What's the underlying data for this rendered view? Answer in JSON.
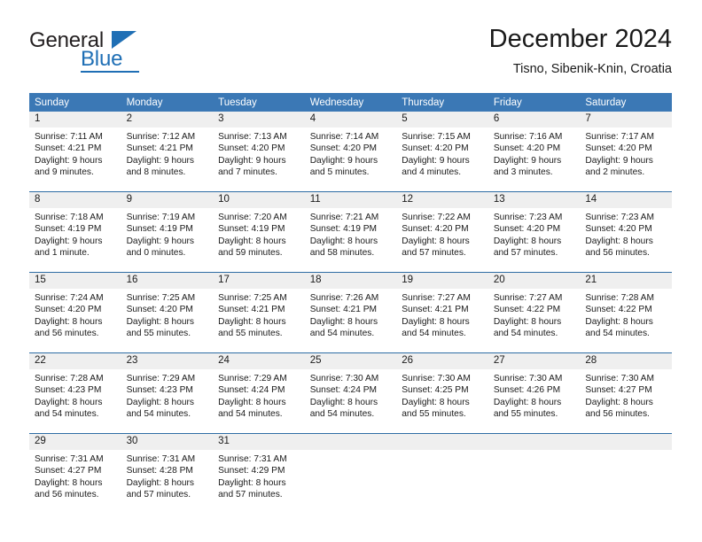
{
  "brand": {
    "name_part1": "General",
    "name_part2": "Blue"
  },
  "header": {
    "title": "December 2024",
    "subtitle": "Tisno, Sibenik-Knin, Croatia"
  },
  "colors": {
    "header_blue": "#3b78b5",
    "row_border_blue": "#2e6da4",
    "daynum_gray": "#efefef",
    "brand_blue": "#1f6fb5"
  },
  "weekday_headers": [
    "Sunday",
    "Monday",
    "Tuesday",
    "Wednesday",
    "Thursday",
    "Friday",
    "Saturday"
  ],
  "labels": {
    "sunrise_prefix": "Sunrise:",
    "sunset_prefix": "Sunset:",
    "daylight_prefix": "Daylight:"
  },
  "weeks": [
    [
      {
        "day": "1",
        "sunrise": "Sunrise: 7:11 AM",
        "sunset": "Sunset: 4:21 PM",
        "daylight": "Daylight: 9 hours and 9 minutes."
      },
      {
        "day": "2",
        "sunrise": "Sunrise: 7:12 AM",
        "sunset": "Sunset: 4:21 PM",
        "daylight": "Daylight: 9 hours and 8 minutes."
      },
      {
        "day": "3",
        "sunrise": "Sunrise: 7:13 AM",
        "sunset": "Sunset: 4:20 PM",
        "daylight": "Daylight: 9 hours and 7 minutes."
      },
      {
        "day": "4",
        "sunrise": "Sunrise: 7:14 AM",
        "sunset": "Sunset: 4:20 PM",
        "daylight": "Daylight: 9 hours and 5 minutes."
      },
      {
        "day": "5",
        "sunrise": "Sunrise: 7:15 AM",
        "sunset": "Sunset: 4:20 PM",
        "daylight": "Daylight: 9 hours and 4 minutes."
      },
      {
        "day": "6",
        "sunrise": "Sunrise: 7:16 AM",
        "sunset": "Sunset: 4:20 PM",
        "daylight": "Daylight: 9 hours and 3 minutes."
      },
      {
        "day": "7",
        "sunrise": "Sunrise: 7:17 AM",
        "sunset": "Sunset: 4:20 PM",
        "daylight": "Daylight: 9 hours and 2 minutes."
      }
    ],
    [
      {
        "day": "8",
        "sunrise": "Sunrise: 7:18 AM",
        "sunset": "Sunset: 4:19 PM",
        "daylight": "Daylight: 9 hours and 1 minute."
      },
      {
        "day": "9",
        "sunrise": "Sunrise: 7:19 AM",
        "sunset": "Sunset: 4:19 PM",
        "daylight": "Daylight: 9 hours and 0 minutes."
      },
      {
        "day": "10",
        "sunrise": "Sunrise: 7:20 AM",
        "sunset": "Sunset: 4:19 PM",
        "daylight": "Daylight: 8 hours and 59 minutes."
      },
      {
        "day": "11",
        "sunrise": "Sunrise: 7:21 AM",
        "sunset": "Sunset: 4:19 PM",
        "daylight": "Daylight: 8 hours and 58 minutes."
      },
      {
        "day": "12",
        "sunrise": "Sunrise: 7:22 AM",
        "sunset": "Sunset: 4:20 PM",
        "daylight": "Daylight: 8 hours and 57 minutes."
      },
      {
        "day": "13",
        "sunrise": "Sunrise: 7:23 AM",
        "sunset": "Sunset: 4:20 PM",
        "daylight": "Daylight: 8 hours and 57 minutes."
      },
      {
        "day": "14",
        "sunrise": "Sunrise: 7:23 AM",
        "sunset": "Sunset: 4:20 PM",
        "daylight": "Daylight: 8 hours and 56 minutes."
      }
    ],
    [
      {
        "day": "15",
        "sunrise": "Sunrise: 7:24 AM",
        "sunset": "Sunset: 4:20 PM",
        "daylight": "Daylight: 8 hours and 56 minutes."
      },
      {
        "day": "16",
        "sunrise": "Sunrise: 7:25 AM",
        "sunset": "Sunset: 4:20 PM",
        "daylight": "Daylight: 8 hours and 55 minutes."
      },
      {
        "day": "17",
        "sunrise": "Sunrise: 7:25 AM",
        "sunset": "Sunset: 4:21 PM",
        "daylight": "Daylight: 8 hours and 55 minutes."
      },
      {
        "day": "18",
        "sunrise": "Sunrise: 7:26 AM",
        "sunset": "Sunset: 4:21 PM",
        "daylight": "Daylight: 8 hours and 54 minutes."
      },
      {
        "day": "19",
        "sunrise": "Sunrise: 7:27 AM",
        "sunset": "Sunset: 4:21 PM",
        "daylight": "Daylight: 8 hours and 54 minutes."
      },
      {
        "day": "20",
        "sunrise": "Sunrise: 7:27 AM",
        "sunset": "Sunset: 4:22 PM",
        "daylight": "Daylight: 8 hours and 54 minutes."
      },
      {
        "day": "21",
        "sunrise": "Sunrise: 7:28 AM",
        "sunset": "Sunset: 4:22 PM",
        "daylight": "Daylight: 8 hours and 54 minutes."
      }
    ],
    [
      {
        "day": "22",
        "sunrise": "Sunrise: 7:28 AM",
        "sunset": "Sunset: 4:23 PM",
        "daylight": "Daylight: 8 hours and 54 minutes."
      },
      {
        "day": "23",
        "sunrise": "Sunrise: 7:29 AM",
        "sunset": "Sunset: 4:23 PM",
        "daylight": "Daylight: 8 hours and 54 minutes."
      },
      {
        "day": "24",
        "sunrise": "Sunrise: 7:29 AM",
        "sunset": "Sunset: 4:24 PM",
        "daylight": "Daylight: 8 hours and 54 minutes."
      },
      {
        "day": "25",
        "sunrise": "Sunrise: 7:30 AM",
        "sunset": "Sunset: 4:24 PM",
        "daylight": "Daylight: 8 hours and 54 minutes."
      },
      {
        "day": "26",
        "sunrise": "Sunrise: 7:30 AM",
        "sunset": "Sunset: 4:25 PM",
        "daylight": "Daylight: 8 hours and 55 minutes."
      },
      {
        "day": "27",
        "sunrise": "Sunrise: 7:30 AM",
        "sunset": "Sunset: 4:26 PM",
        "daylight": "Daylight: 8 hours and 55 minutes."
      },
      {
        "day": "28",
        "sunrise": "Sunrise: 7:30 AM",
        "sunset": "Sunset: 4:27 PM",
        "daylight": "Daylight: 8 hours and 56 minutes."
      }
    ],
    [
      {
        "day": "29",
        "sunrise": "Sunrise: 7:31 AM",
        "sunset": "Sunset: 4:27 PM",
        "daylight": "Daylight: 8 hours and 56 minutes."
      },
      {
        "day": "30",
        "sunrise": "Sunrise: 7:31 AM",
        "sunset": "Sunset: 4:28 PM",
        "daylight": "Daylight: 8 hours and 57 minutes."
      },
      {
        "day": "31",
        "sunrise": "Sunrise: 7:31 AM",
        "sunset": "Sunset: 4:29 PM",
        "daylight": "Daylight: 8 hours and 57 minutes."
      },
      {
        "day": "",
        "sunrise": "",
        "sunset": "",
        "daylight": ""
      },
      {
        "day": "",
        "sunrise": "",
        "sunset": "",
        "daylight": ""
      },
      {
        "day": "",
        "sunrise": "",
        "sunset": "",
        "daylight": ""
      },
      {
        "day": "",
        "sunrise": "",
        "sunset": "",
        "daylight": ""
      }
    ]
  ]
}
